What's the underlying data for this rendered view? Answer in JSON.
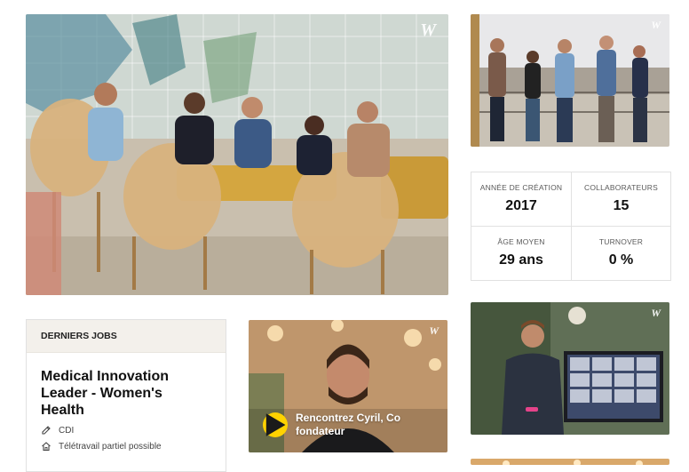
{
  "brand": {
    "logo_glyph": "W",
    "accent": "#ffd200"
  },
  "stats": [
    {
      "label": "Année de création",
      "value": "2017"
    },
    {
      "label": "Collaborateurs",
      "value": "15"
    },
    {
      "label": "Âge moyen",
      "value": "29 ans"
    },
    {
      "label": "Turnover",
      "value": "0 %"
    }
  ],
  "jobs": {
    "header": "DERNIERS JOBS",
    "item": {
      "title": "Medical Innovation Leader - Women's Health",
      "contract": "CDI",
      "remote": "Télétravail partiel possible"
    }
  },
  "video": {
    "caption": "Rencontrez Cyril, Co fondateur"
  },
  "icons": [
    "play-icon",
    "contract-icon",
    "remote-home-icon",
    "welcome-logo-icon"
  ]
}
